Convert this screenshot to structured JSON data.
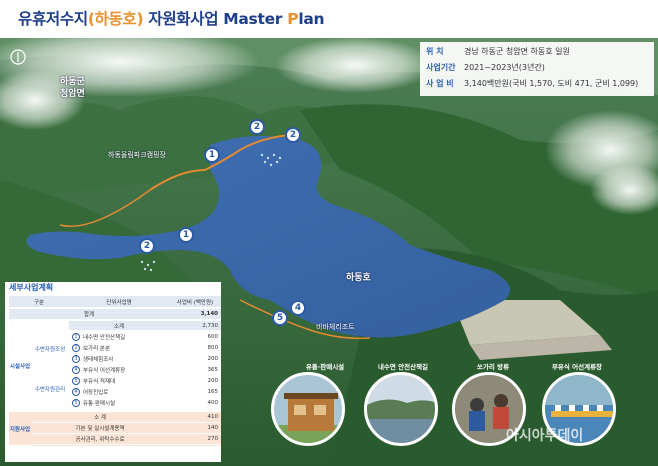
{
  "header": {
    "title_part1": "유휴저수지",
    "title_part2": "(하동호)",
    "title_part3": " 자원화사업 ",
    "title_part4": "Master",
    "title_part5": " ",
    "title_part6": "P",
    "title_part7": "lan"
  },
  "info": {
    "rows": [
      {
        "key": "위    치",
        "value": "경남 하동군 청암면 하동호 일원"
      },
      {
        "key": "사업기간",
        "value": "2021~2023년(3년간)"
      },
      {
        "key": "사 업 비",
        "value": "3,140백만원(국비 1,570, 도비 471, 군비 1,099)"
      }
    ]
  },
  "map": {
    "labels": {
      "district": "하동군",
      "township": "청암면",
      "camping": "하동율림파크캠핑장",
      "lake": "하동호",
      "resort": "비바체리조트"
    },
    "markers": [
      "1",
      "2",
      "2",
      "1",
      "2",
      "4",
      "5"
    ]
  },
  "table": {
    "title": "세부사업계획",
    "headers": {
      "category": "구분",
      "project": "단위사업명",
      "budget": "사업비 (백만원)"
    },
    "total_label": "합계",
    "total_value": "3,140",
    "group1": {
      "name": "시설사업",
      "subtotal_label": "소계",
      "subtotal_value": "2,730",
      "sub1": "수변자원조성",
      "sub2": "수변자원관리",
      "items": [
        {
          "num": "1",
          "name": "내수면 안전산책길",
          "value": "600"
        },
        {
          "num": "2",
          "name": "보가리 분분",
          "value": "800"
        },
        {
          "num": "3",
          "name": "생태체험조사",
          "value": "200"
        },
        {
          "num": "4",
          "name": "부유식 어선계류장",
          "value": "365"
        },
        {
          "num": "5",
          "name": "부유식 적재대",
          "value": "200"
        },
        {
          "num": "4",
          "name": "어장진입로",
          "value": "165"
        },
        {
          "num": "5",
          "name": "유통·판매시설",
          "value": "400"
        }
      ]
    },
    "group2": {
      "name": "지원사업",
      "subtotal_label": "소 계",
      "subtotal_value": "410",
      "items": [
        {
          "name": "기본 및 실시설계용역",
          "value": "140"
        },
        {
          "name": "공사관리, 위탁수수료",
          "value": "270"
        }
      ]
    }
  },
  "photos": [
    {
      "label": "유통·판매시설"
    },
    {
      "label": "내수면 안전산책길"
    },
    {
      "label": "쏘가리 방류"
    },
    {
      "label": "부유식 어선계류장"
    }
  ],
  "watermark": "아시아투데이",
  "colors": {
    "accent": "#2b5fb5",
    "highlight": "#e8912d",
    "lake": "#3f6fb3"
  }
}
